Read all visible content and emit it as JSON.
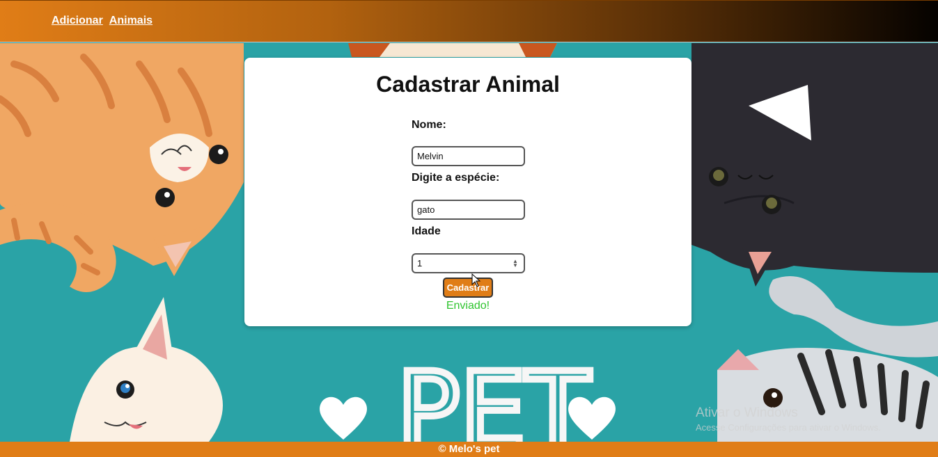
{
  "nav": {
    "add_label": "Adicionar",
    "animals_label": "Animais"
  },
  "form": {
    "title": "Cadastrar Animal",
    "name_label": "Nome:",
    "name_value": "Melvin",
    "species_label": "Digite a espécie:",
    "species_value": "gato",
    "age_label": "Idade",
    "age_value": "1",
    "submit_label": "Cadastrar",
    "status_message": "Enviado!"
  },
  "background": {
    "pet_text": "PET"
  },
  "footer": {
    "text": "© Melo's pet"
  },
  "watermark": {
    "line1": "Ativar o Windows",
    "line2": "Acesse Configurações para ativar o Windows."
  },
  "colors": {
    "accent": "#e07d17",
    "teal": "#2aa3a6",
    "success": "#2ec42e"
  }
}
